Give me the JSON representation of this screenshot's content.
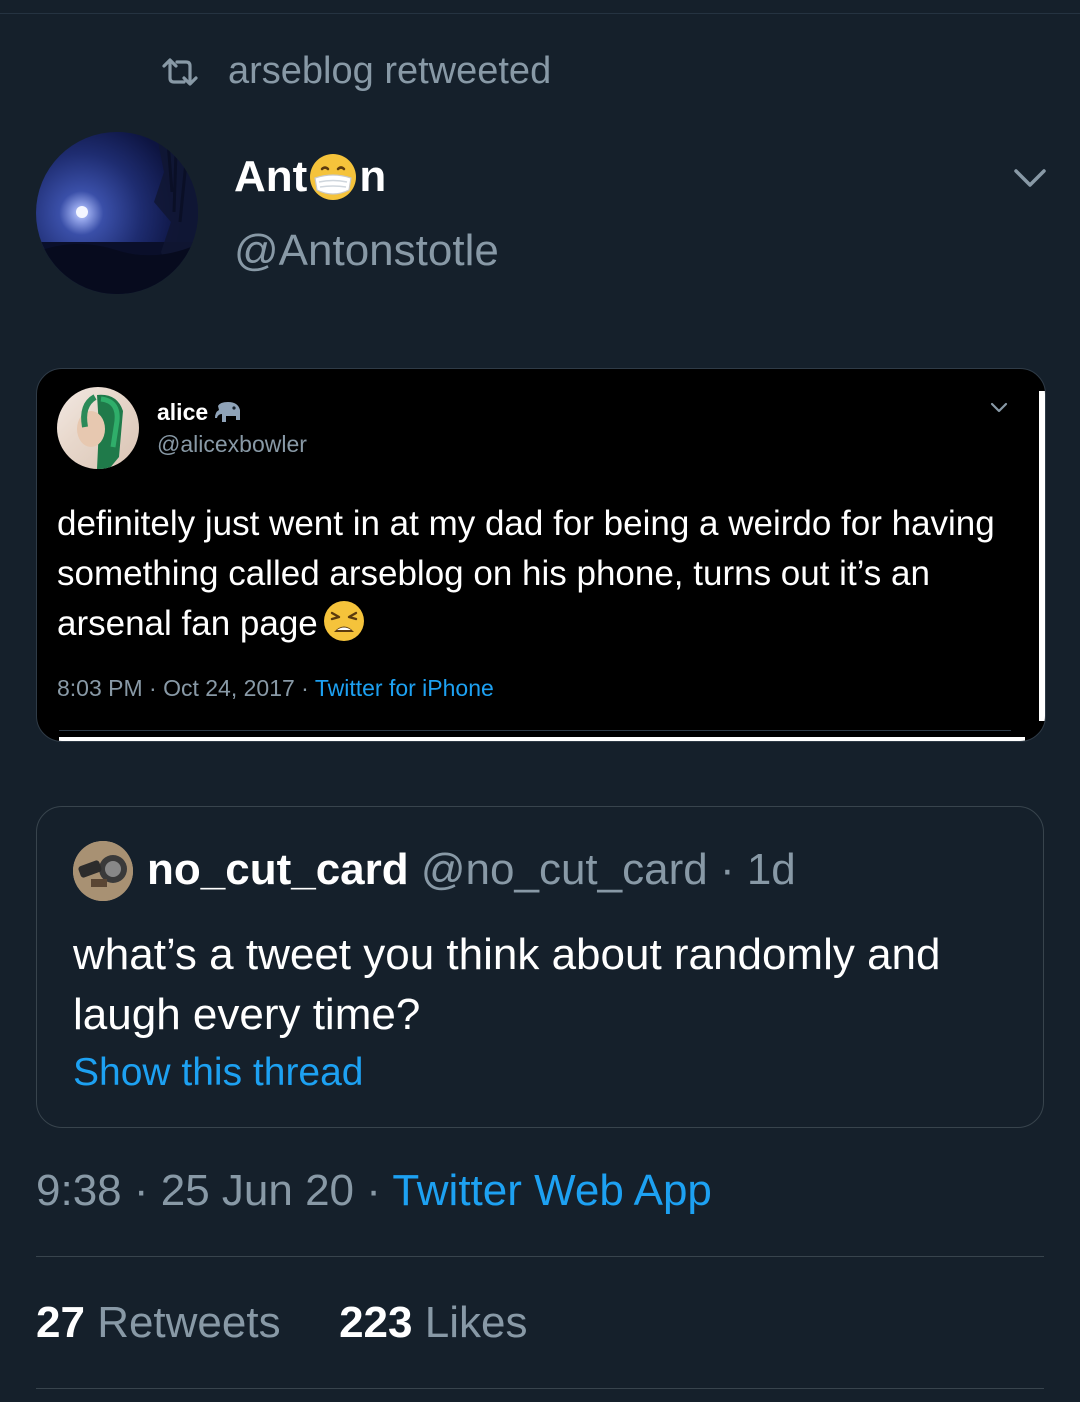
{
  "retweet_header": {
    "icon": "retweet-icon",
    "text": "arseblog retweeted"
  },
  "author": {
    "name_prefix": "Ant",
    "name_suffix": "n",
    "name_emoji": "face-with-medical-mask-icon",
    "handle": "@Antonstotle"
  },
  "embedded_tweet": {
    "name": "alice",
    "name_emoji": "elephant-icon",
    "handle": "@alicexbowler",
    "text": "definitely just went in at my dad for being a weirdo for having something called arseblog on his phone, turns out it’s an arsenal fan page",
    "text_emoji": "weary-face-icon",
    "meta_time": "8:03 PM · Oct 24, 2017 · ",
    "meta_source": "Twitter for iPhone"
  },
  "quoted_tweet": {
    "name": "no_cut_card",
    "handle_time": "@no_cut_card · 1d",
    "text": "what’s a tweet you think about randomly and laugh every time?",
    "link": "Show this thread"
  },
  "timestamp": {
    "time_date": "9:38 · 25 Jun 20 · ",
    "source": "Twitter Web App"
  },
  "stats": {
    "retweets_count": "27",
    "retweets_label": "Retweets",
    "likes_count": "223",
    "likes_label": "Likes"
  },
  "colors": {
    "background": "#15202b",
    "secondary_text": "#8899a6",
    "link": "#1da1f2",
    "border": "#38444d"
  }
}
